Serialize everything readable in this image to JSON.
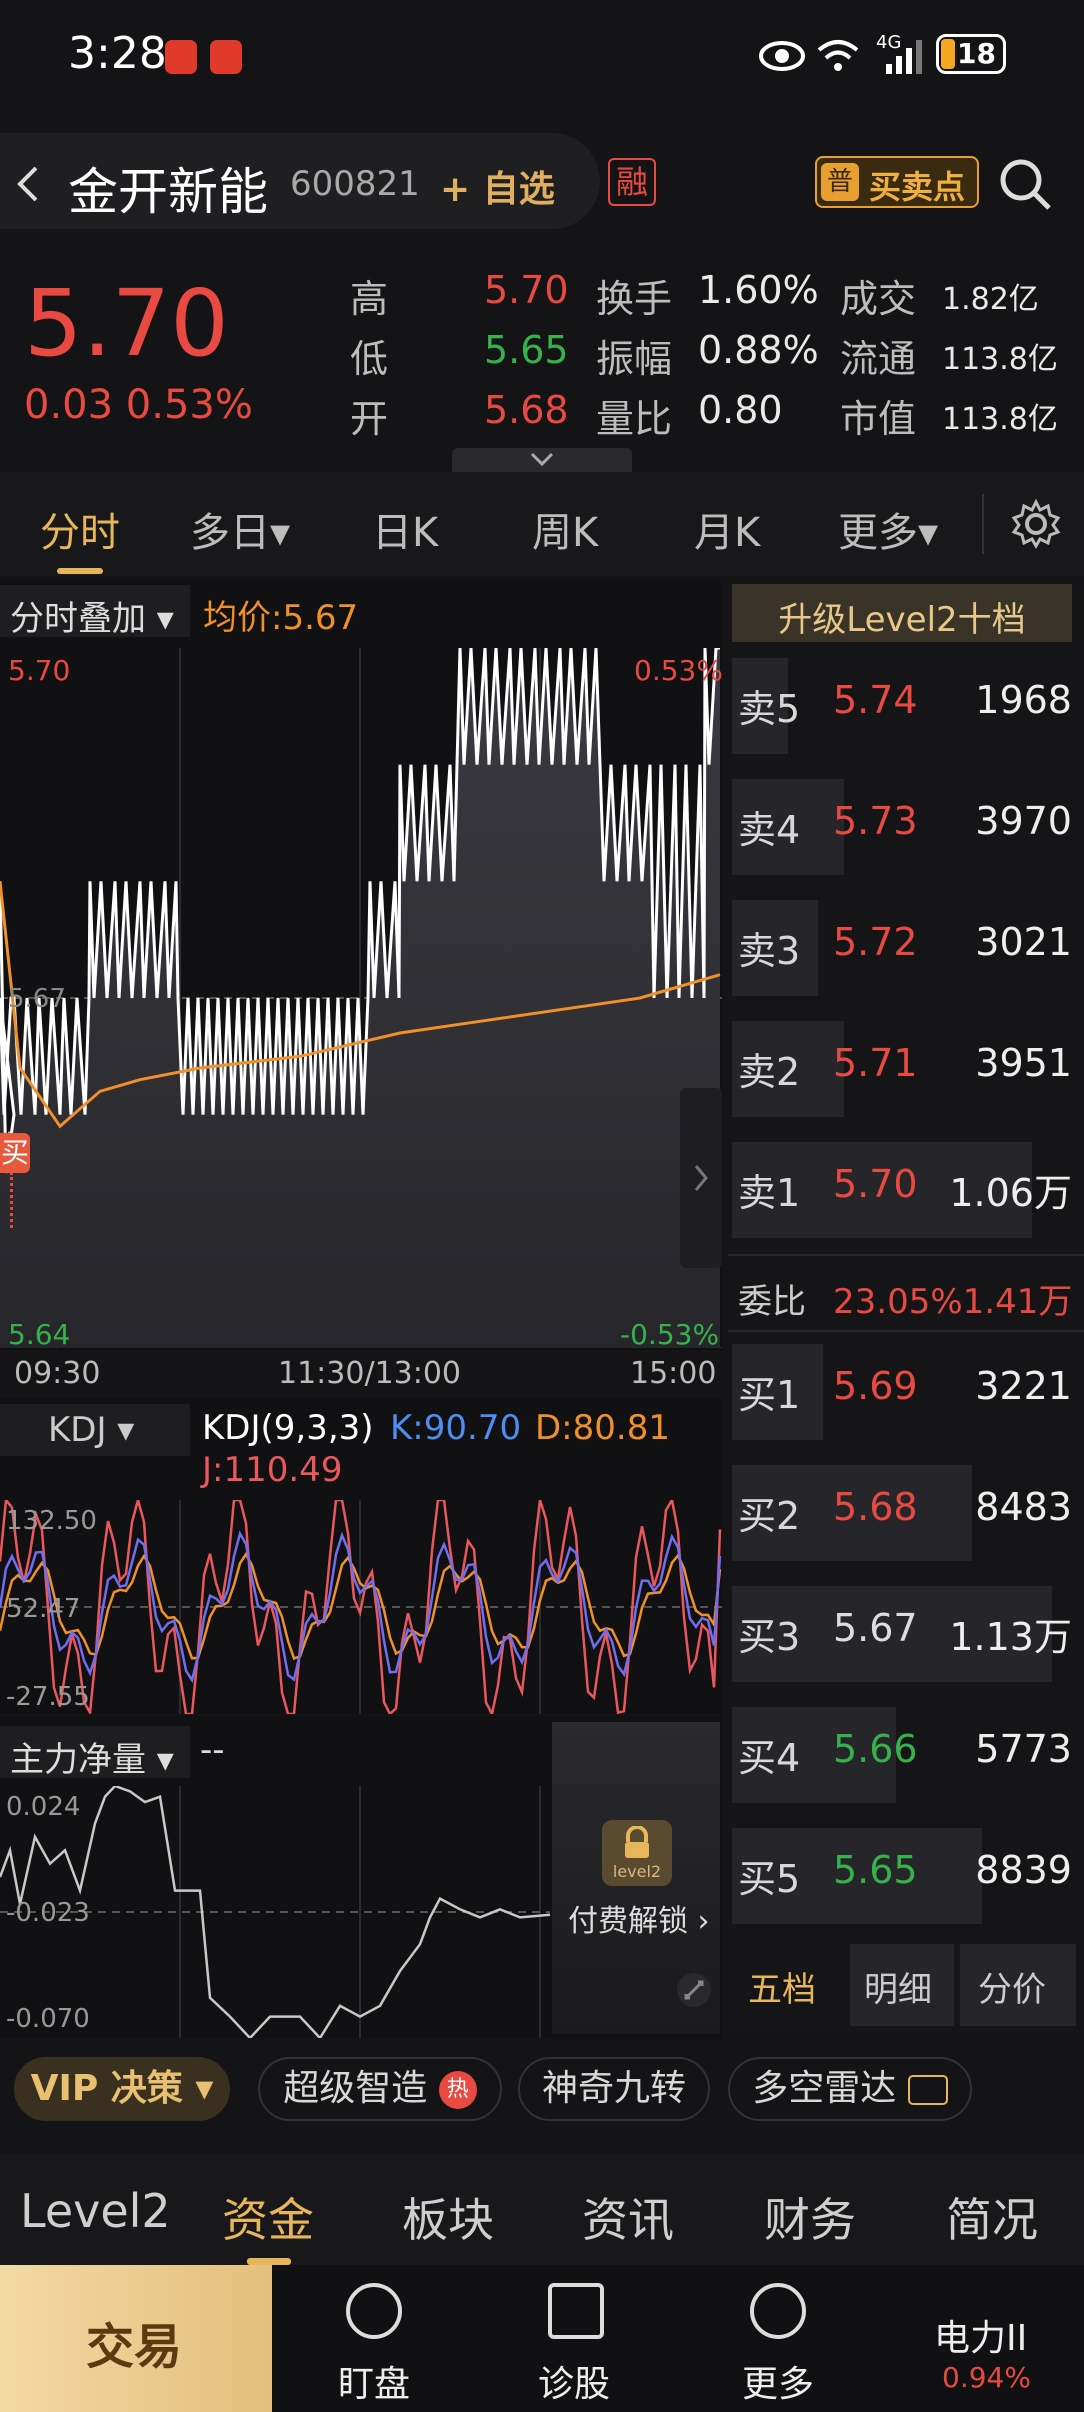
{
  "status_bar": {
    "time": "3:28",
    "battery": "18",
    "network": "4G"
  },
  "header": {
    "back": "<",
    "name": "金开新能",
    "code": "600821",
    "add_watch": "+ 自选",
    "margin_badge": "融",
    "buysell_badge": "普",
    "buysell": "买卖点"
  },
  "quote": {
    "price": "5.70",
    "change": "0.03 0.53%",
    "stats": [
      {
        "l1": "高",
        "v1": "5.70",
        "l2": "换手",
        "v2": "1.60%",
        "l3": "成交",
        "v3": "1.82亿"
      },
      {
        "l1": "低",
        "v1": "5.65",
        "l2": "振幅",
        "v2": "0.88%",
        "l3": "流通",
        "v3": "113.8亿"
      },
      {
        "l1": "开",
        "v1": "5.68",
        "l2": "量比",
        "v2": "0.80",
        "l3": "市值",
        "v3": "113.8亿"
      }
    ]
  },
  "tabs": [
    "分时",
    "多日▾",
    "日K",
    "周K",
    "月K",
    "更多▾"
  ],
  "intraday": {
    "overlay": "分时叠加 ▾",
    "avg_label": "均价:5.67",
    "top_price": "5.70",
    "top_pct": "0.53%",
    "mid_price": "5.67",
    "bottom_price": "5.64",
    "bottom_pct": "-0.53%",
    "times": [
      "09:30",
      "11:30/13:00",
      "15:00"
    ],
    "buy_marker": "买",
    "colors": {
      "price": "#ffffff",
      "avg": "#f0902a"
    }
  },
  "kdj": {
    "selector": "KDJ ▾",
    "params": "KDJ(9,3,3)",
    "k": "K:90.70",
    "d": "D:80.81",
    "j": "J:110.49",
    "top": "132.50",
    "mid": "52.47",
    "bottom": "-27.55"
  },
  "capital": {
    "selector": "主力净量 ▾",
    "value": "--",
    "top": "0.024",
    "mid": "-0.023",
    "bottom": "-0.070",
    "lock_text": "付费解锁 ›",
    "lock_badge": "level2"
  },
  "depth": {
    "upgrade": "升级Level2十档",
    "asks": [
      {
        "label": "卖5",
        "price": "5.74",
        "vol": "1968"
      },
      {
        "label": "卖4",
        "price": "5.73",
        "vol": "3970"
      },
      {
        "label": "卖3",
        "price": "5.72",
        "vol": "3021"
      },
      {
        "label": "卖2",
        "price": "5.71",
        "vol": "3951"
      },
      {
        "label": "卖1",
        "price": "5.70",
        "vol": "1.06万"
      }
    ],
    "ratio_label": "委比",
    "ratio_value": "23.05%1.41万",
    "bids": [
      {
        "label": "买1",
        "price": "5.69",
        "vol": "3221"
      },
      {
        "label": "买2",
        "price": "5.68",
        "vol": "8483"
      },
      {
        "label": "买3",
        "price": "5.67",
        "vol": "1.13万"
      },
      {
        "label": "买4",
        "price": "5.66",
        "vol": "5773"
      },
      {
        "label": "买5",
        "price": "5.65",
        "vol": "8839"
      }
    ],
    "tabs": [
      "五档",
      "明细",
      "分价"
    ]
  },
  "tools": {
    "vip": "VIP 决策 ▾",
    "chips": [
      "超级智造",
      "神奇九转",
      "多空雷达"
    ],
    "hot": "热"
  },
  "bottom_tabs": [
    "Level2",
    "资金",
    "板块",
    "资讯",
    "财务",
    "简况"
  ],
  "bottom_bar": {
    "trade": "交易",
    "items": [
      "盯盘",
      "诊股",
      "更多"
    ],
    "sector_name": "电力II",
    "sector_pct": "0.94%"
  }
}
